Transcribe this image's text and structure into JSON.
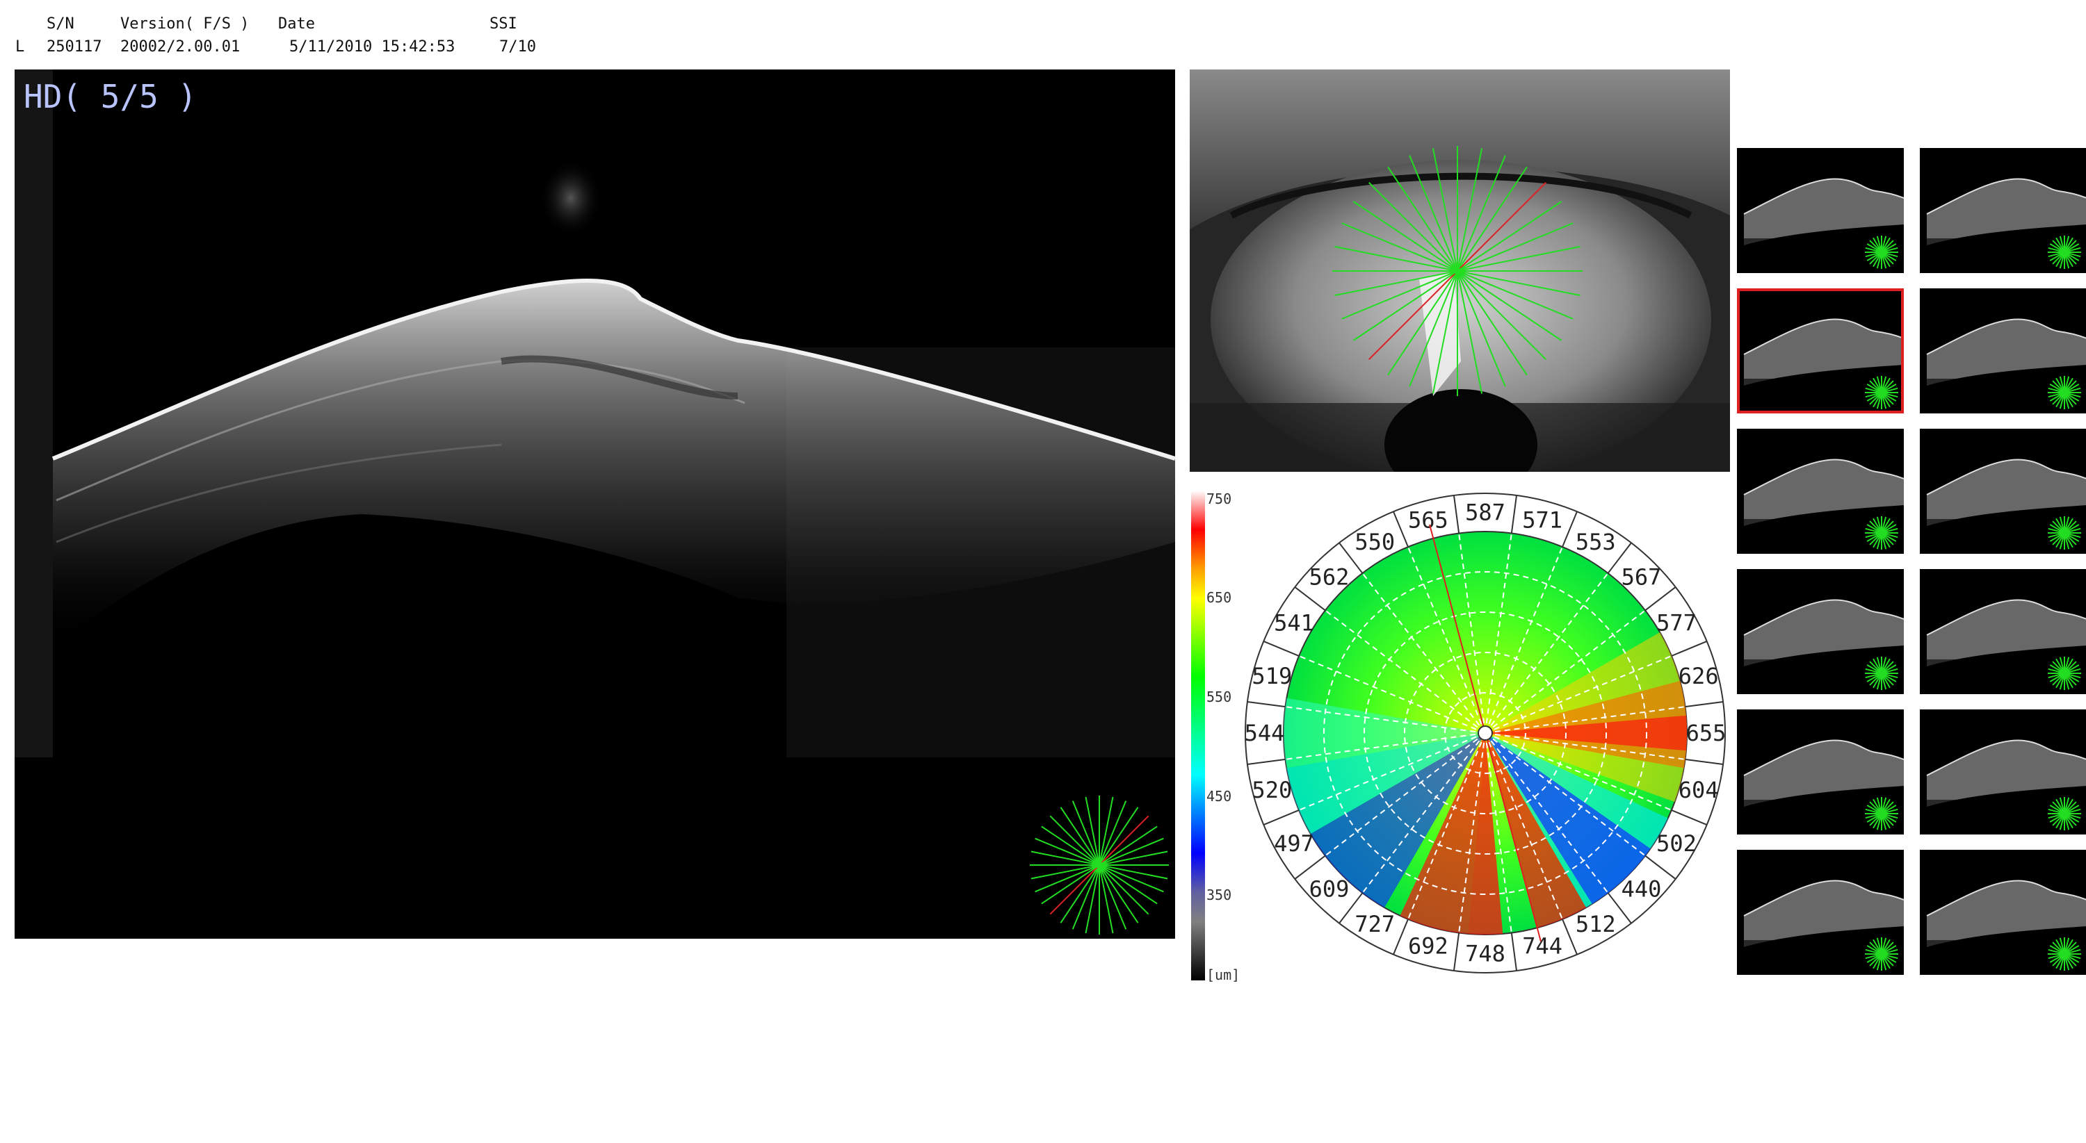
{
  "header": {
    "col_sn": "S/N",
    "col_version": "Version( F/S )",
    "col_date": "Date",
    "col_ssi": "SSI",
    "eye": "L",
    "serial": "250117",
    "version": "20002/2.00.01",
    "date": "5/11/2010 15:42:53",
    "ssi": "7/10"
  },
  "bscan": {
    "label": "HD( 5/5 )"
  },
  "colorbar": {
    "ticks": [
      "750",
      "650",
      "550",
      "450",
      "350"
    ],
    "unit": "[um]"
  },
  "pachymetry": {
    "sector_values": [
      "587",
      "571",
      "553",
      "567",
      "577",
      "626",
      "655",
      "604",
      "502",
      "440",
      "512",
      "744",
      "748",
      "692",
      "727",
      "609",
      "497",
      "520",
      "544",
      "519",
      "541",
      "562",
      "550",
      "565"
    ]
  },
  "thumbnails": {
    "count": 12,
    "selected_index": 2
  },
  "colors": {
    "scan_line_green": "#22dd22",
    "scan_line_red": "#dd2020",
    "label_blue": "#b9c4ff",
    "selected_border": "#e02020"
  }
}
